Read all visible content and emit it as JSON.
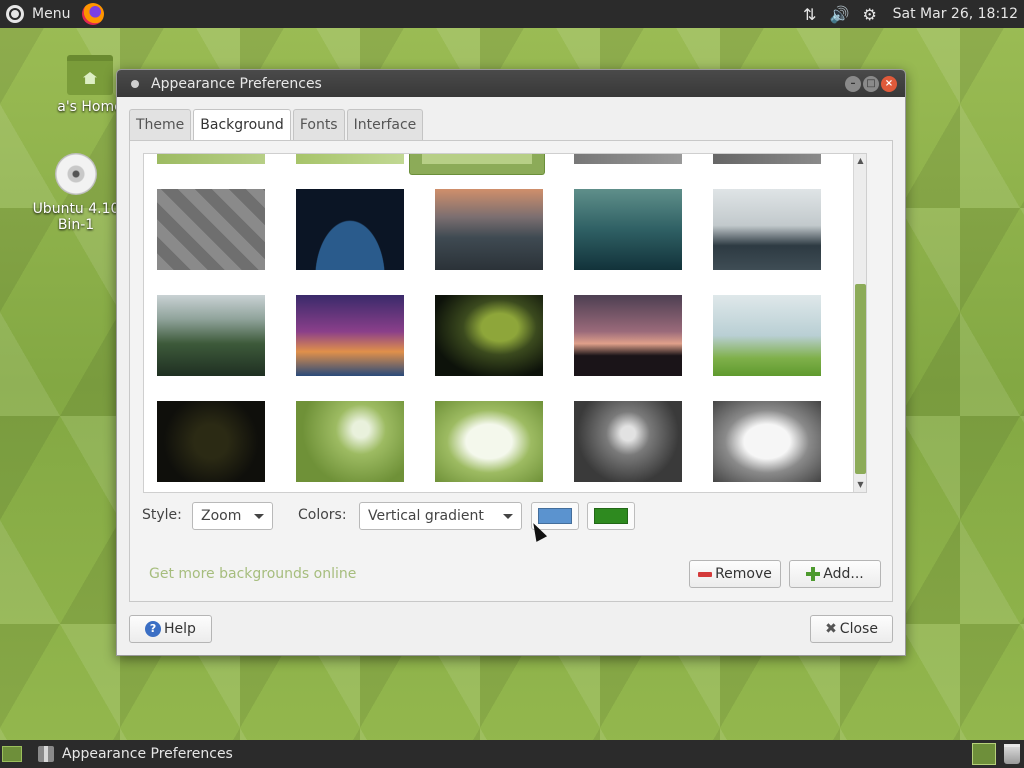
{
  "top_panel": {
    "menu_label": "Menu",
    "clock": "Sat Mar 26, 18:12"
  },
  "desktop": {
    "home_label": "a's Home",
    "disc_label_line1": "Ubuntu 4.10",
    "disc_label_line2": "Bin-1"
  },
  "window": {
    "title": "Appearance Preferences",
    "tabs": [
      {
        "label": "Theme"
      },
      {
        "label": "Background"
      },
      {
        "label": "Fonts"
      },
      {
        "label": "Interface"
      }
    ],
    "active_tab": "Background",
    "style_label": "Style:",
    "style_value": "Zoom",
    "colors_label": "Colors:",
    "colors_value": "Vertical gradient",
    "primary_color": "#5b93cf",
    "secondary_color": "#2e8a1f",
    "more_link": "Get more backgrounds online",
    "remove_label": "Remove",
    "add_label": "Add...",
    "help_label": "Help",
    "close_label": "Close"
  },
  "taskbar": {
    "task_label": "Appearance Preferences"
  },
  "colors": {
    "accent": "#8cab58",
    "panel": "#2b2b2b"
  }
}
